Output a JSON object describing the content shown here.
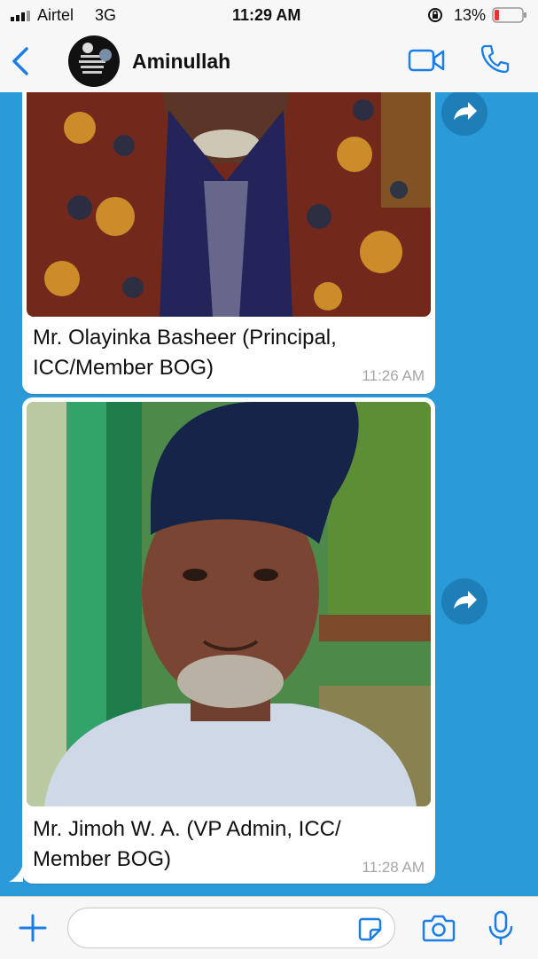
{
  "status_bar": {
    "carrier": "Airtel",
    "network": "3G",
    "time": "11:29 AM",
    "battery": "13%"
  },
  "header": {
    "contact_name": "Aminullah",
    "back_icon": "chevron-left-icon",
    "video_icon": "video-camera-icon",
    "call_icon": "phone-icon"
  },
  "messages": [
    {
      "caption_lines": [
        "Mr. Olayinka Basheer (Principal,",
        "ICC/Member BOG)"
      ],
      "time": "11:26 AM"
    },
    {
      "caption_lines": [
        "Mr. Jimoh W. A. (VP Admin, ICC/",
        "Member BOG)"
      ],
      "time": "11:28 AM"
    }
  ],
  "input_bar": {
    "message_value": "",
    "icons": [
      "plus-icon",
      "sticker-icon",
      "camera-icon",
      "microphone-icon"
    ]
  },
  "colors": {
    "chat_background": "#2a9bd8",
    "accent": "#1a7ee6",
    "bubble": "#ffffff"
  }
}
